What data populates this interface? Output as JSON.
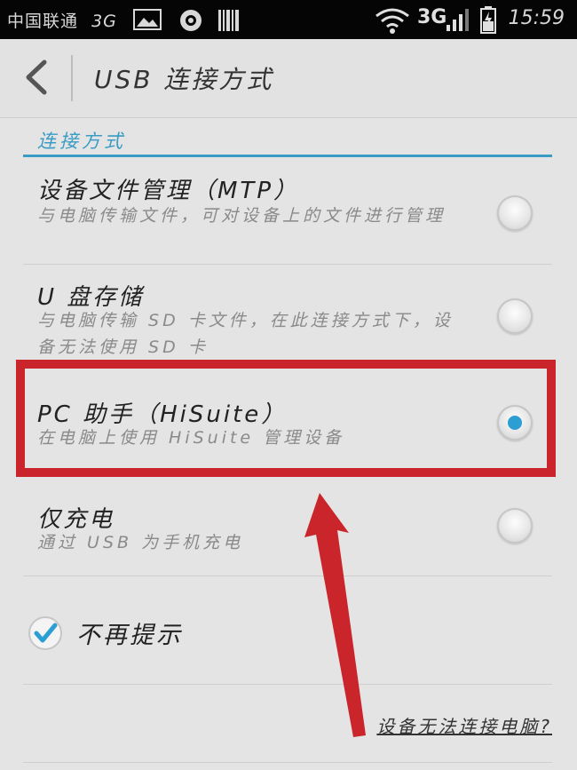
{
  "status_bar": {
    "carrier": "中国联通",
    "network_left": "3G",
    "network_right": "3G",
    "time": "15:59"
  },
  "header": {
    "title": "USB 连接方式"
  },
  "section": {
    "title": "连接方式"
  },
  "options": [
    {
      "title": "设备文件管理（MTP）",
      "desc": "与电脑传输文件，可对设备上的文件进行管理",
      "checked": false
    },
    {
      "title": "U 盘存储",
      "desc": "与电脑传输 SD 卡文件，在此连接方式下，设备无法使用 SD 卡",
      "checked": false
    },
    {
      "title": "PC 助手（HiSuite）",
      "desc": "在电脑上使用 HiSuite 管理设备",
      "checked": true
    },
    {
      "title": "仅充电",
      "desc": "通过 USB 为手机充电",
      "checked": false
    }
  ],
  "remind": {
    "label": "不再提示",
    "checked": true
  },
  "help_link": "设备无法连接电脑?",
  "colors": {
    "accent": "#3a9bc4",
    "radio_selected": "#2d9ed3",
    "annotation_red": "#c9252a"
  }
}
